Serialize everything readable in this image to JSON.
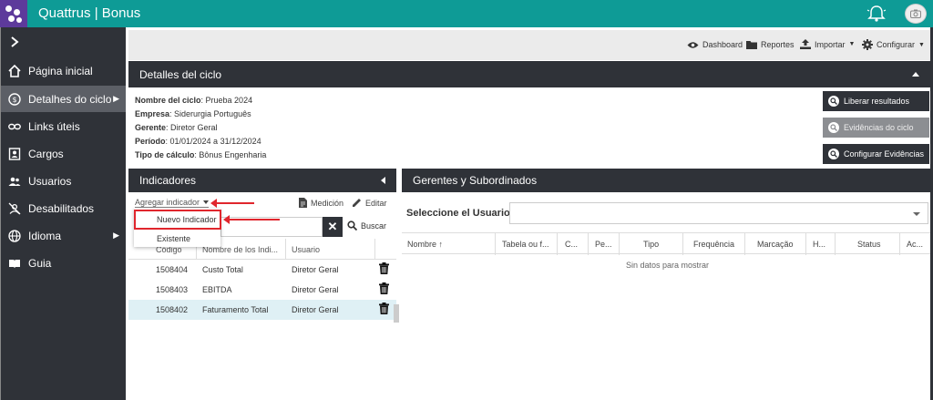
{
  "app": {
    "title": "Quattrus | Bonus"
  },
  "topbar": {
    "bell_icon": "bell-icon",
    "avatar_icon": "camera-icon"
  },
  "sidebar": {
    "toggle_icon": "chevron-right-icon",
    "items": [
      {
        "label": "Página inicial",
        "icon": "home-icon"
      },
      {
        "label": "Detalhes do ciclo",
        "icon": "cycle-icon",
        "active": true,
        "submenu": true
      },
      {
        "label": "Links úteis",
        "icon": "link-icon"
      },
      {
        "label": "Cargos",
        "icon": "badge-icon"
      },
      {
        "label": "Usuarios",
        "icon": "users-icon"
      },
      {
        "label": "Desabilitados",
        "icon": "user-off-icon"
      },
      {
        "label": "Idioma",
        "icon": "globe-icon",
        "submenu": true
      },
      {
        "label": "Guia",
        "icon": "book-icon"
      }
    ]
  },
  "toolbar": {
    "dashboard": "Dashboard",
    "reportes": "Reportes",
    "importar": "Importar",
    "configurar": "Configurar"
  },
  "details": {
    "header": "Detalles del ciclo",
    "fields": [
      {
        "label": "Nombre del ciclo",
        "value": ": Prueba 2024"
      },
      {
        "label": "Empresa",
        "value": ": Siderurgia Português"
      },
      {
        "label": "Gerente",
        "value": ": Diretor Geral"
      },
      {
        "label": "Período",
        "value": ": 01/01/2024 a 31/12/2024"
      },
      {
        "label": "Tipo de cálculo",
        "value": ": Bônus Engenharia"
      }
    ],
    "buttons": {
      "liberar": "Liberar resultados",
      "evidencias": "Evidências do ciclo",
      "configurar_evidencias": "Configurar Evidências"
    }
  },
  "indicators": {
    "header": "Indicadores",
    "add_link": "Agregar indicador",
    "medicion": "Medición",
    "editar": "Editar",
    "buscar": "Buscar",
    "dropdown": [
      "Nuevo Indicador",
      "Existente"
    ],
    "columns": [
      "Código",
      "Nombre de los Indi...",
      "Usuario"
    ],
    "rows": [
      {
        "code": "1508404",
        "name": "Custo Total",
        "user": "Diretor Geral"
      },
      {
        "code": "1508403",
        "name": "EBITDA",
        "user": "Diretor Geral"
      },
      {
        "code": "1508402",
        "name": "Faturamento Total",
        "user": "Diretor Geral",
        "selected": true
      }
    ]
  },
  "managers": {
    "header": "Gerentes y Subordinados",
    "select_label": "Seleccione el Usuario",
    "select_value": "",
    "columns": [
      "Nombre",
      "Tabela ou f...",
      "C...",
      "Pe...",
      "Tipo",
      "Frequência",
      "Marcação",
      "H...",
      "Status",
      "Ac..."
    ],
    "sort_indicator": "↑",
    "empty": "Sin datos para mostrar"
  },
  "colors": {
    "teal": "#0e9b96",
    "purple": "#5d3a9b",
    "dark": "#2f3238",
    "annotation_red": "#e0262d"
  }
}
